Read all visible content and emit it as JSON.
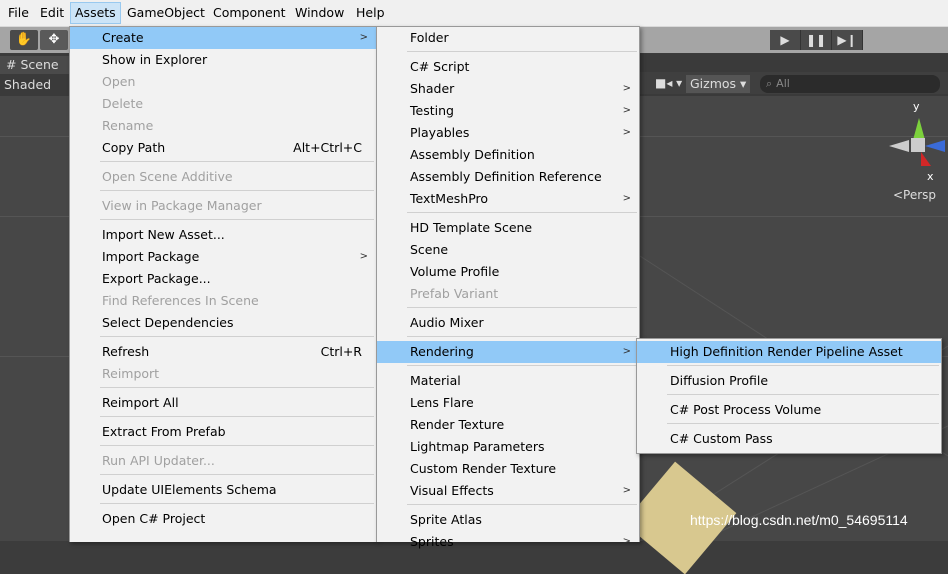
{
  "menubar": [
    "File",
    "Edit",
    "Assets",
    "GameObject",
    "Component",
    "Window",
    "Help"
  ],
  "toolbar": {
    "hand_icon": "hand-icon",
    "move_icon": "move-icon",
    "play": "▶",
    "pause": "❚❚",
    "step": "▶❙"
  },
  "scene": {
    "tab": "# Scene",
    "shading": "Shaded",
    "gizmos": "Gizmos",
    "search_placeholder": "All",
    "persp": "<Persp",
    "axis_y": "y",
    "axis_x": "x"
  },
  "assets_menu": [
    {
      "label": "Create",
      "arrow": true,
      "highlight": true
    },
    {
      "label": "Show in Explorer"
    },
    {
      "label": "Open",
      "disabled": true
    },
    {
      "label": "Delete",
      "disabled": true
    },
    {
      "label": "Rename",
      "disabled": true
    },
    {
      "label": "Copy Path",
      "shortcut": "Alt+Ctrl+C"
    },
    {
      "label": "Open Scene Additive",
      "disabled": true
    },
    {
      "label": "View in Package Manager",
      "disabled": true
    },
    {
      "label": "Import New Asset..."
    },
    {
      "label": "Import Package",
      "arrow": true
    },
    {
      "label": "Export Package..."
    },
    {
      "label": "Find References In Scene",
      "disabled": true
    },
    {
      "label": "Select Dependencies"
    },
    {
      "label": "Refresh",
      "shortcut": "Ctrl+R"
    },
    {
      "label": "Reimport",
      "disabled": true
    },
    {
      "label": "Reimport All"
    },
    {
      "label": "Extract From Prefab"
    },
    {
      "label": "Run API Updater...",
      "disabled": true
    },
    {
      "label": "Update UIElements Schema"
    },
    {
      "label": "Open C# Project"
    }
  ],
  "create_menu": [
    {
      "label": "Folder"
    },
    {
      "label": "C# Script"
    },
    {
      "label": "Shader",
      "arrow": true
    },
    {
      "label": "Testing",
      "arrow": true
    },
    {
      "label": "Playables",
      "arrow": true
    },
    {
      "label": "Assembly Definition"
    },
    {
      "label": "Assembly Definition Reference"
    },
    {
      "label": "TextMeshPro",
      "arrow": true
    },
    {
      "label": "HD Template Scene"
    },
    {
      "label": "Scene"
    },
    {
      "label": "Volume Profile"
    },
    {
      "label": "Prefab Variant",
      "disabled": true
    },
    {
      "label": "Audio Mixer"
    },
    {
      "label": "Rendering",
      "arrow": true,
      "highlight": true
    },
    {
      "label": "Material"
    },
    {
      "label": "Lens Flare"
    },
    {
      "label": "Render Texture"
    },
    {
      "label": "Lightmap Parameters"
    },
    {
      "label": "Custom Render Texture"
    },
    {
      "label": "Visual Effects",
      "arrow": true
    },
    {
      "label": "Sprite Atlas"
    },
    {
      "label": "Sprites",
      "arrow": true
    }
  ],
  "rendering_menu": [
    {
      "label": "High Definition Render Pipeline Asset",
      "highlight": true
    },
    {
      "label": "Diffusion Profile"
    },
    {
      "label": "C# Post Process Volume"
    },
    {
      "label": "C# Custom Pass"
    }
  ],
  "watermark": "https://blog.csdn.net/m0_54695114",
  "colors": {
    "highlight": "#91c9f7",
    "menu_bg": "#f2f2f2",
    "disabled": "#a0a0a0"
  }
}
